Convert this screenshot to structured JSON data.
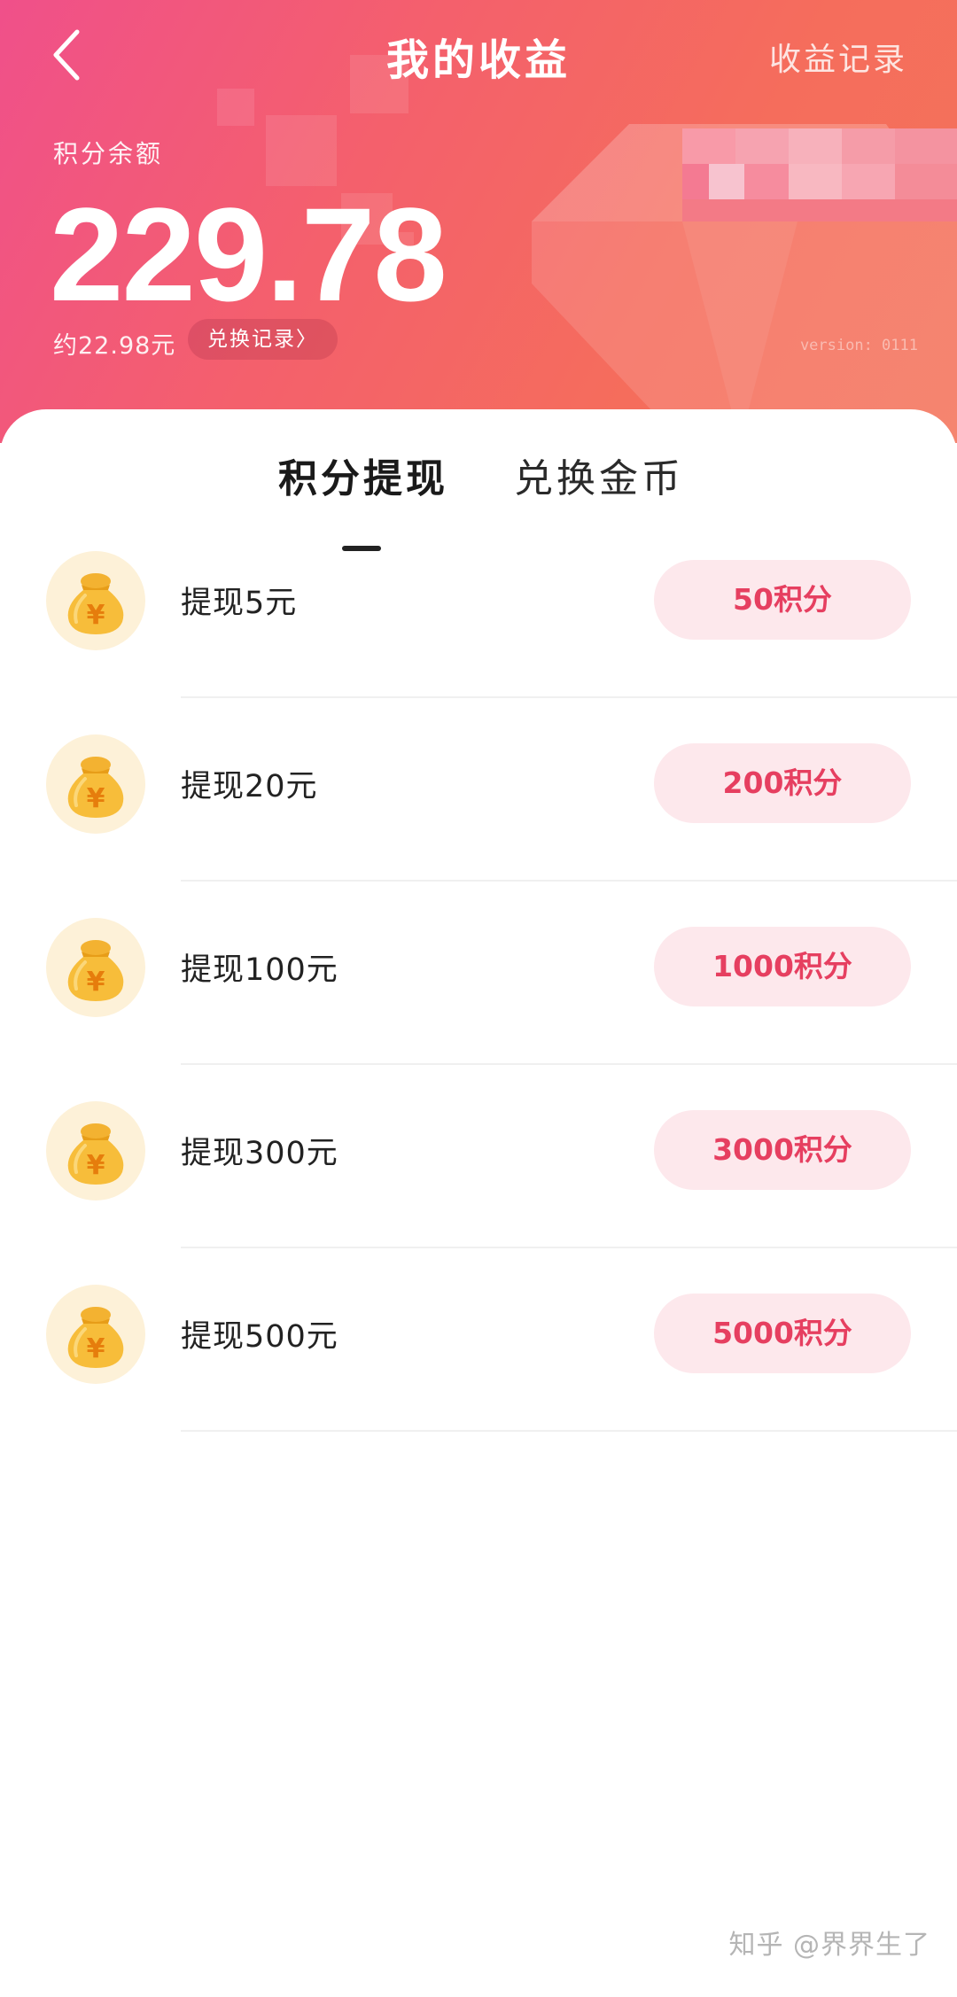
{
  "header": {
    "title": "我的收益",
    "right_action": "收益记录",
    "balance_label": "积分余额",
    "balance_value": "229.78",
    "approx_text": "约22.98元",
    "exchange_record_label": "兑换记录〉",
    "version_text": "version: 0111"
  },
  "tabs": {
    "active": "积分提现",
    "inactive": "兑换金币"
  },
  "items": [
    {
      "label": "提现5元",
      "button": "50积分"
    },
    {
      "label": "提现20元",
      "button": "200积分"
    },
    {
      "label": "提现100元",
      "button": "1000积分"
    },
    {
      "label": "提现300元",
      "button": "3000积分"
    },
    {
      "label": "提现500元",
      "button": "5000积分"
    }
  ],
  "icons": {
    "back": "chevron-left-icon",
    "money_bag": "money-bag-icon"
  },
  "colors": {
    "header_gradient_start": "#f0508a",
    "header_gradient_end": "#f4735a",
    "button_bg": "#fde8ec",
    "button_text": "#e63f60"
  },
  "watermark": "知乎 @界界生了"
}
